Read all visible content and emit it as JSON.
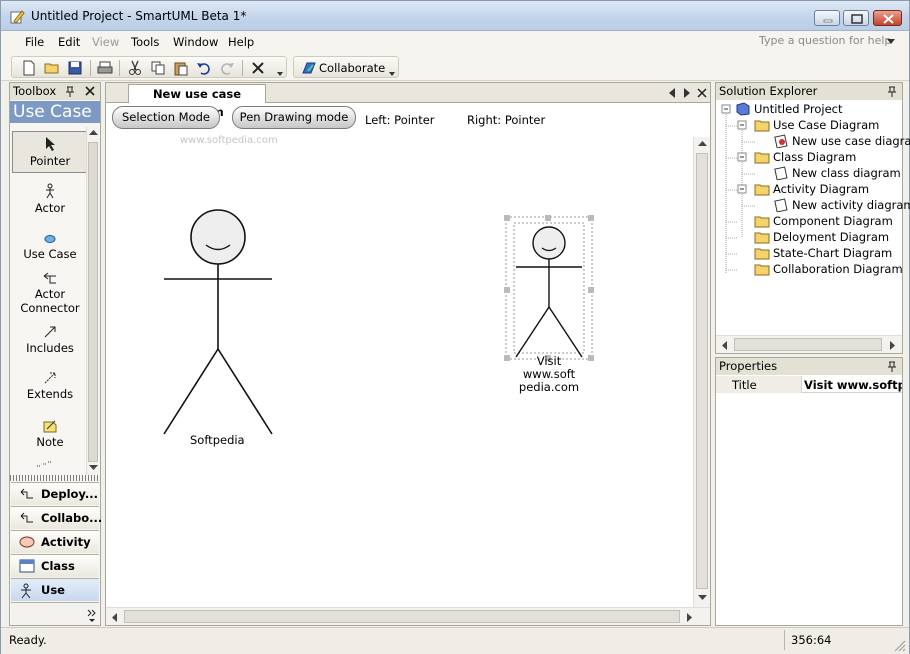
{
  "window": {
    "title": "Untitled Project - SmartUML Beta 1*"
  },
  "menu": {
    "items": [
      {
        "label": "File",
        "disabled": false
      },
      {
        "label": "Edit",
        "disabled": false
      },
      {
        "label": "View",
        "disabled": true
      },
      {
        "label": "Tools",
        "disabled": false
      },
      {
        "label": "Window",
        "disabled": false
      },
      {
        "label": "Help",
        "disabled": false
      }
    ],
    "help_placeholder": "Type a question for help"
  },
  "toolbar": {
    "collaborate_label": "Collaborate"
  },
  "toolbox": {
    "header": "Toolbox",
    "title": "Use Case",
    "tools": [
      {
        "label": "Pointer",
        "icon": "pointer-icon",
        "selected": true
      },
      {
        "label": "Actor",
        "icon": "actor-icon"
      },
      {
        "label": "Use Case",
        "icon": "use-case-icon"
      },
      {
        "label": "Actor Connector",
        "icon": "actor-connector-icon"
      },
      {
        "label": "Includes",
        "icon": "includes-icon"
      },
      {
        "label": "Extends",
        "icon": "extends-icon"
      },
      {
        "label": "Note",
        "icon": "note-icon"
      }
    ],
    "categories": [
      {
        "label": "Deploy...",
        "icon": "deployment-icon"
      },
      {
        "label": "Collabo...",
        "icon": "collaboration-icon"
      },
      {
        "label": "Activity",
        "icon": "activity-icon"
      },
      {
        "label": "Class",
        "icon": "class-icon"
      },
      {
        "label": "Use Case",
        "icon": "use-case-category-icon",
        "active": true
      }
    ]
  },
  "document": {
    "tab": "New use case diagram",
    "selection_mode": "Selection Mode",
    "pen_mode": "Pen Drawing mode",
    "left_label": "Left: Pointer",
    "right_label": "Right: Pointer",
    "watermark": "www.softpedia.com",
    "actors": [
      {
        "label": "Softpedia"
      },
      {
        "label_lines": [
          "Visit",
          "www.soft",
          "pedia.com"
        ]
      }
    ]
  },
  "solution_explorer": {
    "header": "Solution Explorer",
    "tree": [
      {
        "label": "Untitled Project",
        "icon": "project-icon"
      },
      {
        "label": "Use Case Diagram",
        "icon": "folder-icon"
      },
      {
        "label": "New use case diagram",
        "icon": "use-case-diagram-icon"
      },
      {
        "label": "Class Diagram",
        "icon": "folder-icon"
      },
      {
        "label": "New class diagram",
        "icon": "diagram-icon"
      },
      {
        "label": "Activity Diagram",
        "icon": "folder-icon"
      },
      {
        "label": "New activity diagram",
        "icon": "diagram-icon"
      },
      {
        "label": "Component Diagram",
        "icon": "folder-icon"
      },
      {
        "label": "Deloyment Diagram",
        "icon": "folder-icon"
      },
      {
        "label": "State-Chart Diagram",
        "icon": "folder-icon"
      },
      {
        "label": "Collaboration Diagram",
        "icon": "folder-icon"
      }
    ]
  },
  "properties": {
    "header": "Properties",
    "rows": [
      {
        "name": "Title",
        "value": "Visit www.softped"
      }
    ]
  },
  "status": {
    "text": "Ready.",
    "coords": "356:64"
  }
}
